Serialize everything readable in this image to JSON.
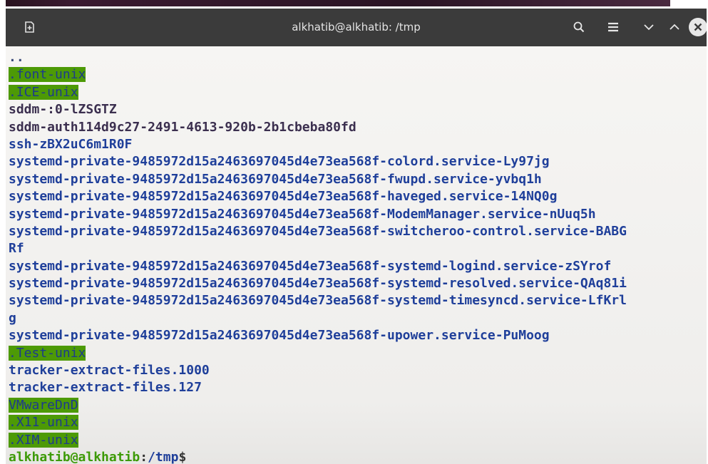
{
  "window": {
    "title": "alkhatib@alkhatib: /tmp"
  },
  "terminal": {
    "lines": [
      {
        "text": "..",
        "style": "dim"
      },
      {
        "text": ".font-unix",
        "style": "hl"
      },
      {
        "text": ".ICE-unix",
        "style": "hl"
      },
      {
        "text": "sddm-:0-lZSGTZ",
        "style": "plain"
      },
      {
        "text": "sddm-auth114d9c27-2491-4613-920b-2b1cbeba80fd",
        "style": "plain"
      },
      {
        "text": "ssh-zBX2uC6m1R0F",
        "style": "dir"
      },
      {
        "text": "systemd-private-9485972d15a2463697045d4e73ea568f-colord.service-Ly97jg",
        "style": "dir"
      },
      {
        "text": "systemd-private-9485972d15a2463697045d4e73ea568f-fwupd.service-yvbq1h",
        "style": "dir"
      },
      {
        "text": "systemd-private-9485972d15a2463697045d4e73ea568f-haveged.service-14NQ0g",
        "style": "dir"
      },
      {
        "text": "systemd-private-9485972d15a2463697045d4e73ea568f-ModemManager.service-nUuq5h",
        "style": "dir"
      },
      {
        "text": "systemd-private-9485972d15a2463697045d4e73ea568f-switcheroo-control.service-BABG",
        "style": "dir"
      },
      {
        "text": "Rf",
        "style": "dir"
      },
      {
        "text": "systemd-private-9485972d15a2463697045d4e73ea568f-systemd-logind.service-zSYrof",
        "style": "dir"
      },
      {
        "text": "systemd-private-9485972d15a2463697045d4e73ea568f-systemd-resolved.service-QAq81i",
        "style": "dir"
      },
      {
        "text": "systemd-private-9485972d15a2463697045d4e73ea568f-systemd-timesyncd.service-LfKrl",
        "style": "dir"
      },
      {
        "text": "g",
        "style": "dir"
      },
      {
        "text": "systemd-private-9485972d15a2463697045d4e73ea568f-upower.service-PuMoog",
        "style": "dir"
      },
      {
        "text": ".Test-unix",
        "style": "hl"
      },
      {
        "text": "tracker-extract-files.1000",
        "style": "dir"
      },
      {
        "text": "tracker-extract-files.127",
        "style": "dir"
      },
      {
        "text": "VMwareDnD",
        "style": "hl"
      },
      {
        "text": ".X11-unix",
        "style": "hl"
      },
      {
        "text": ".XIM-unix",
        "style": "hl"
      }
    ],
    "prompt": {
      "user_host": "alkhatib@alkhatib",
      "separator": ":",
      "path": "/tmp",
      "symbol": "$"
    }
  },
  "colors": {
    "titlebar": "#3b3b3b",
    "background": "#f3f2f0",
    "directory": "#1f3f9a",
    "highlight": "#4d9a06",
    "prompt_user": "#3c9a06"
  }
}
